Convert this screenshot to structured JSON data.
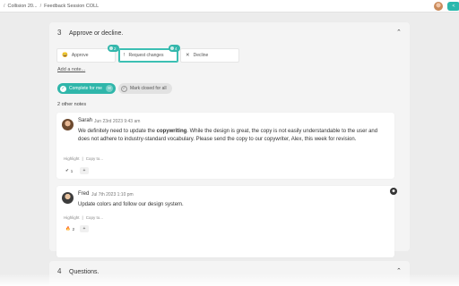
{
  "breadcrumb": {
    "sep": "/",
    "items": [
      "Collision 20...",
      "Feedback Session COLL"
    ]
  },
  "header_actions": {
    "share_icon": "share-icon"
  },
  "section3": {
    "number": "3",
    "title": "Approve or decline.",
    "options": [
      {
        "label": "Approve",
        "icon": "😀"
      },
      {
        "label": "Request changes",
        "icon": "!"
      },
      {
        "label": "Decline",
        "icon": "✕"
      }
    ],
    "badges": [
      "2",
      "4"
    ],
    "add_note": "Add a note...",
    "complete_label": "Complete for me",
    "closed_label": "Mark closed for all",
    "notes_count": "2 other notes",
    "notes": [
      {
        "author": "Sarah",
        "date": "Jun 23rd 2023 9:43 am",
        "text_before": "We definitely need to update the ",
        "text_bold": "copywriting",
        "text_after": ". While the design is great, the copy is not easily understandable to the user and does not adhere to industry-standard vocabulary. Please send the copy to our copywriter, Alex, this week for revision.",
        "highlight": "Highlight",
        "copy": "Copy to...",
        "reaction_icon": "✔",
        "reaction_count": "1",
        "add_reaction": "+"
      },
      {
        "author": "Fred",
        "date": "Jul 7th 2023 1:10 pm",
        "text": "Update colors and follow our design system.",
        "highlight": "Highlight",
        "copy": "Copy to...",
        "reaction_icon": "🔥",
        "reaction_count": "2",
        "add_reaction": "+"
      }
    ]
  },
  "section4": {
    "number": "4",
    "title": "Questions."
  },
  "colors": {
    "accent": "#2fb6aa",
    "card": "#f4f4f4",
    "page": "#ececec"
  }
}
